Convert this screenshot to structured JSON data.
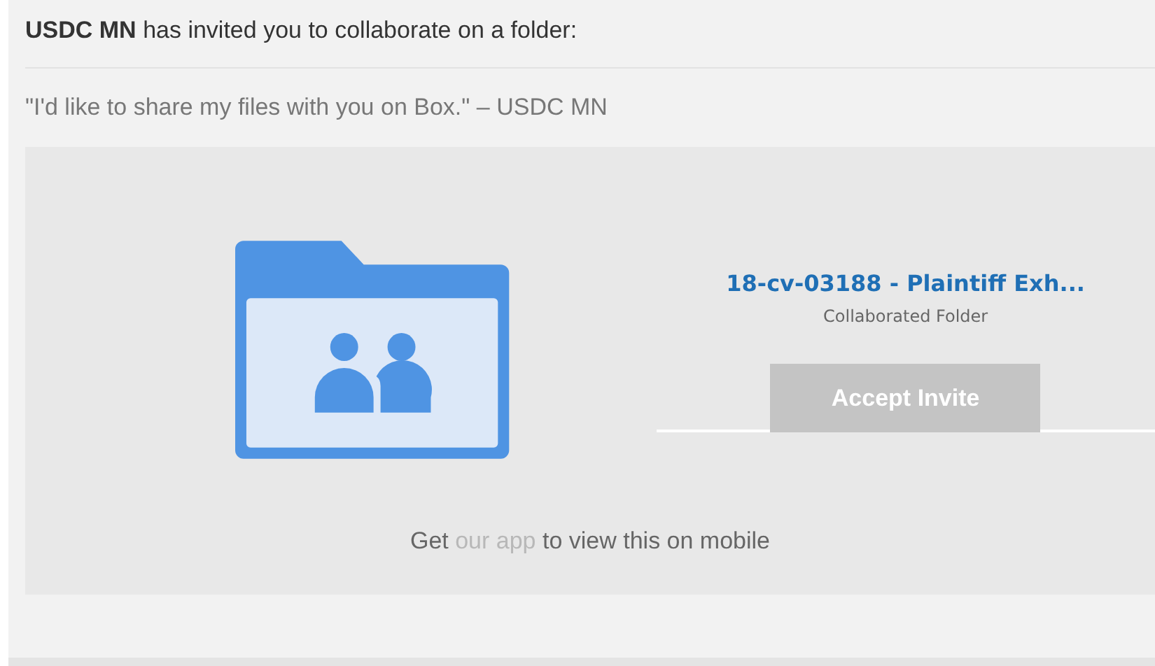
{
  "invite_message": "**USDC MN** has invited you to collaborate on a folder:",
  "quote": "\"I'd like to share my files with you on Box.\" – USDC MN",
  "folder": {
    "name": "18-cv-03188 - Plaintiff Exh...",
    "type_label": "Collaborated Folder"
  },
  "accept_button": "Accept Invite",
  "mobile_note": {
    "before": "Get ",
    "link": "our app",
    "after": " to view this on mobile"
  }
}
